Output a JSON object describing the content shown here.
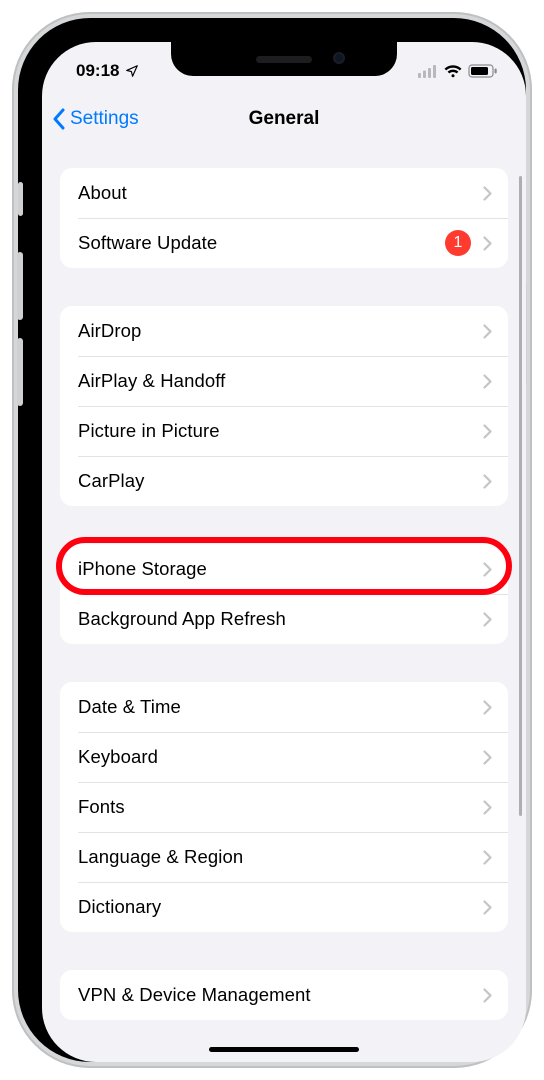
{
  "status": {
    "time": "09:18",
    "location_icon": "location-arrow",
    "signal_bars": 4,
    "wifi": true,
    "battery_pct": 78
  },
  "nav": {
    "back_label": "Settings",
    "title": "General"
  },
  "groups": [
    {
      "rows": [
        {
          "label": "About",
          "name": "row-about"
        },
        {
          "label": "Software Update",
          "name": "row-software-update",
          "badge": "1"
        }
      ]
    },
    {
      "rows": [
        {
          "label": "AirDrop",
          "name": "row-airdrop"
        },
        {
          "label": "AirPlay & Handoff",
          "name": "row-airplay-handoff"
        },
        {
          "label": "Picture in Picture",
          "name": "row-picture-in-picture"
        },
        {
          "label": "CarPlay",
          "name": "row-carplay"
        }
      ]
    },
    {
      "rows": [
        {
          "label": "iPhone Storage",
          "name": "row-iphone-storage",
          "highlight": true
        },
        {
          "label": "Background App Refresh",
          "name": "row-background-app-refresh"
        }
      ]
    },
    {
      "rows": [
        {
          "label": "Date & Time",
          "name": "row-date-time"
        },
        {
          "label": "Keyboard",
          "name": "row-keyboard"
        },
        {
          "label": "Fonts",
          "name": "row-fonts"
        },
        {
          "label": "Language & Region",
          "name": "row-language-region"
        },
        {
          "label": "Dictionary",
          "name": "row-dictionary"
        }
      ]
    },
    {
      "rows": [
        {
          "label": "VPN & Device Management",
          "name": "row-vpn-device-management"
        }
      ]
    }
  ],
  "annotation": {
    "highlight_color": "#ff0010"
  }
}
